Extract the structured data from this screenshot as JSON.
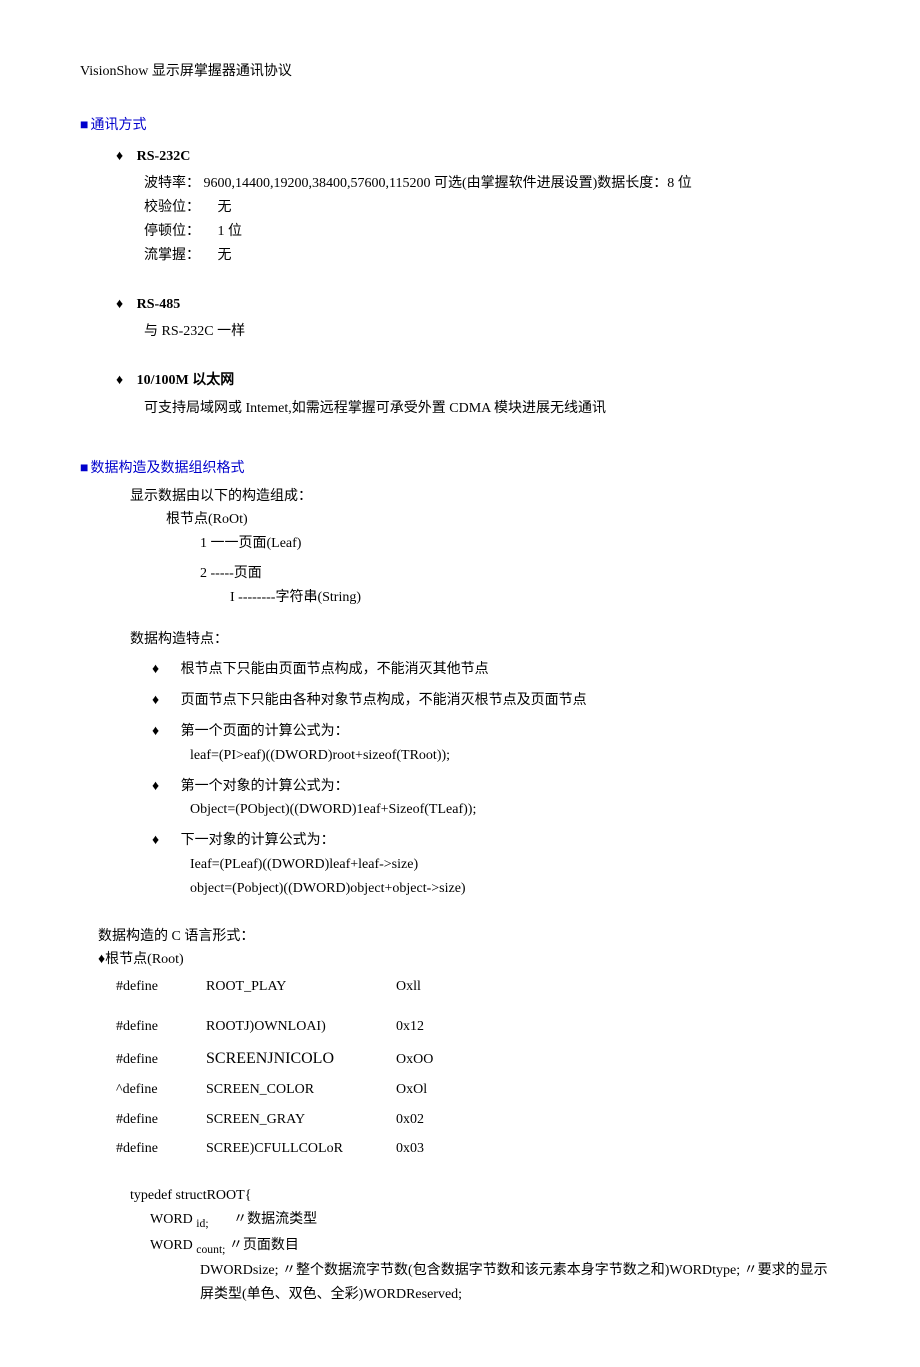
{
  "title": "VisionShow 显示屏掌握器通讯协议",
  "section1": {
    "heading": "通讯方式",
    "items": [
      {
        "name": "RS-232C",
        "lines": {
          "baud": "波特率： 9600,14400,19200,38400,57600,115200 可选(由掌握软件进展设置)数据长度：8 位",
          "check_label": "校验位：",
          "check_val": "无",
          "stop_label": "停顿位：",
          "stop_val": "1 位",
          "flow_label": "流掌握：",
          "flow_val": "无"
        }
      },
      {
        "name": "RS-485",
        "desc": "与 RS-232C 一样"
      },
      {
        "name": "10/100M 以太网",
        "desc": "可支持局域网或 Intemet,如需远程掌握可承受外置 CDMA 模块进展无线通讯"
      }
    ]
  },
  "section2": {
    "heading": "数据构造及数据组织格式",
    "intro": "显示数据由以下的构造组成：",
    "root_label": "根节点(RoOt)",
    "leaf1": "1  一一页面(Leaf)",
    "leaf2": "2  -----页面",
    "leaf2_sub": "I --------字符串(String)",
    "features_label": "数据构造特点：",
    "features": [
      "根节点下只能由页面节点构成，不能消灭其他节点",
      "页面节点下只能由各种对象节点构成，不能消灭根节点及页面节点",
      "第一个页面的计算公式为：",
      "第一个对象的计算公式为：",
      "下一对象的计算公式为："
    ],
    "formulas": {
      "f1": "leaf=(PI>eaf)((DWORD)root+sizeof(TRoot));",
      "f2": "Object=(PObject)((DWORD)1eaf+Sizeof(TLeaf));",
      "f3a": "Ieaf=(PLeaf)((DWORD)leaf+leaf->size)",
      "f3b": "object=(Pobject)((DWORD)object+object->size)"
    },
    "c_heading": "数据构造的 C 语言形式：",
    "root_node": "根节点(Root)",
    "defines": [
      {
        "k": "#define",
        "n": "ROOT_PLAY",
        "v": "Oxll"
      },
      {
        "k": "#define",
        "n": "ROOTJ)OWNLOAI)",
        "v": "0x12"
      },
      {
        "k": "#define",
        "n": "SCREENJNICOLO",
        "v": "OxOO",
        "caps": true
      },
      {
        "k": "^define",
        "n": "SCREEN_COLOR",
        "v": "OxOl"
      },
      {
        "k": "#define",
        "n": "SCREEN_GRAY",
        "v": "0x02"
      },
      {
        "k": "#define",
        "n": "SCREE)CFULLCOLoR",
        "v": "0x03"
      }
    ],
    "typedef": "typedef    structROOT{",
    "fields": {
      "id": "WORD",
      "id_name": "id;",
      "id_comment": "〃数据流类型",
      "count": "WORD",
      "count_name": "count;",
      "count_comment": "〃页面数目",
      "tail": "DWORDsize; 〃整个数据流字节数(包含数据字节数和该元素本身字节数之和)WORDtype; 〃要求的显示屏类型(单色、双色、全彩)WORDReserved;"
    }
  }
}
